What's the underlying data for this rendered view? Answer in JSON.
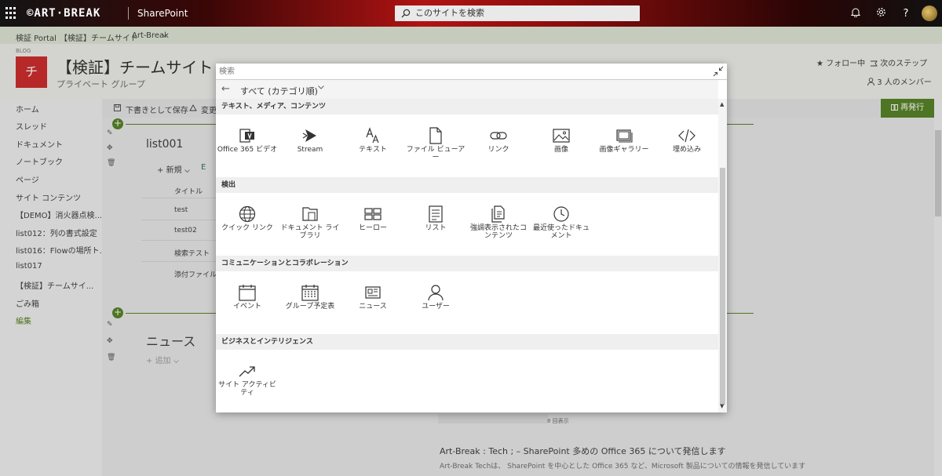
{
  "suite": {
    "logo": "©ART·BREAK",
    "app_name": "SharePoint",
    "search_placeholder": "このサイトを検索",
    "icons": [
      "bell-icon",
      "gear-icon",
      "help-icon",
      "avatar"
    ]
  },
  "hubnav": {
    "items": [
      "検証 Portal",
      "【検証】チームサイト",
      "Art-Break"
    ]
  },
  "site": {
    "tag": "BLOG",
    "logo_letter": "チ",
    "title": "【検証】チームサイト",
    "subtitle": "プライベート グループ",
    "follow": "★ フォロー中",
    "next_step": "次のステップ",
    "members": "3 人のメンバー"
  },
  "leftnav": {
    "items": [
      "ホーム",
      "スレッド",
      "ドキュメント",
      "ノートブック",
      "ページ",
      "サイト コンテンツ",
      "【DEMO】消火器点検...",
      "list012：列の書式設定",
      "list016：Flowの場所ト...",
      "list017",
      "【検証】チームサイ...",
      "ごみ箱"
    ],
    "edit": "編集"
  },
  "cmdbar": {
    "save_draft": "下書きとして保存",
    "change": "変更を",
    "republish": "再発行"
  },
  "page": {
    "list_title": "list001",
    "new": "新規",
    "new_prefix": "+",
    "excel_icon_text": "E",
    "title_column": "タイトル",
    "rows": [
      "test",
      "test02",
      "検索テスト",
      "添付ファイル"
    ],
    "news_title": "ニュース",
    "news_add": "追加",
    "views": "8 回表示",
    "blog_heading": "Art-Break : Tech ; – SharePoint 多めの Office 365 について発信します",
    "blog_text": "Art-Break Techは、 SharePoint を中心とした Office 365 など、Microsoft 製品についての情報を発信しています"
  },
  "modal": {
    "search_placeholder": "検索",
    "filter_label": "すべて (カテゴリ順)",
    "categories": [
      {
        "name": "テキスト、メディア、コンテンツ",
        "tiles": [
          {
            "label": "Office 365 ビデオ",
            "icon": "office365-video-icon"
          },
          {
            "label": "Stream",
            "icon": "stream-icon"
          },
          {
            "label": "テキスト",
            "icon": "text-icon"
          },
          {
            "label": "ファイル ビューアー",
            "icon": "file-viewer-icon"
          },
          {
            "label": "リンク",
            "icon": "link-icon"
          },
          {
            "label": "画像",
            "icon": "image-icon"
          },
          {
            "label": "画像ギャラリー",
            "icon": "image-gallery-icon"
          },
          {
            "label": "埋め込み",
            "icon": "embed-icon"
          }
        ]
      },
      {
        "name": "検出",
        "tiles": [
          {
            "label": "クイック リンク",
            "icon": "globe-icon"
          },
          {
            "label": "ドキュメント ライブラリ",
            "icon": "document-library-icon"
          },
          {
            "label": "ヒーロー",
            "icon": "hero-icon"
          },
          {
            "label": "リスト",
            "icon": "list-icon"
          },
          {
            "label": "強調表示されたコンテンツ",
            "icon": "highlighted-content-icon"
          },
          {
            "label": "最近使ったドキュメント",
            "icon": "clock-icon"
          }
        ]
      },
      {
        "name": "コミュニケーションとコラボレーション",
        "tiles": [
          {
            "label": "イベント",
            "icon": "calendar-icon"
          },
          {
            "label": "グループ予定表",
            "icon": "group-calendar-icon"
          },
          {
            "label": "ニュース",
            "icon": "news-icon"
          },
          {
            "label": "ユーザー",
            "icon": "person-icon"
          }
        ]
      },
      {
        "name": "ビジネスとインテリジェンス",
        "tiles": [
          {
            "label": "サイト アクティビティ",
            "icon": "trend-icon"
          }
        ]
      }
    ]
  }
}
